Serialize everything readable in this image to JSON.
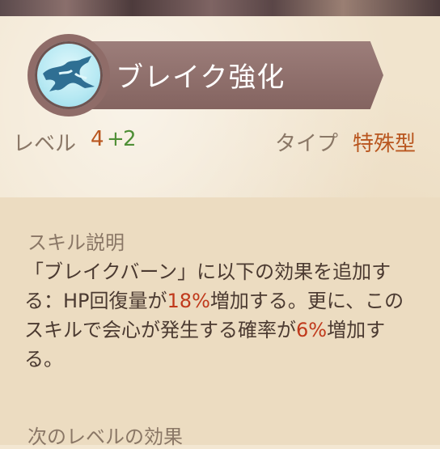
{
  "skill": {
    "title": "ブレイク強化",
    "icon": "ice-crack-icon"
  },
  "stats": {
    "level_label": "レベル",
    "level_base": "4",
    "level_plus": "+",
    "level_bonus": "2",
    "type_label": "タイプ",
    "type_value": "特殊型"
  },
  "description": {
    "section_title": "スキル説明",
    "part1": "「ブレイクバーン」に以下の効果を追加する：HP回復量が",
    "value1": "18%",
    "part2": "増加する。更に、このスキルで会心が発生する確率が",
    "value2": "6%",
    "part3": "増加する。"
  },
  "next_level": {
    "section_title": "次のレベルの効果"
  },
  "colors": {
    "header_bg": "#8f6c68",
    "value_orange": "#b9561f",
    "bonus_green": "#4f8f36",
    "highlight_red": "#c0391b"
  }
}
